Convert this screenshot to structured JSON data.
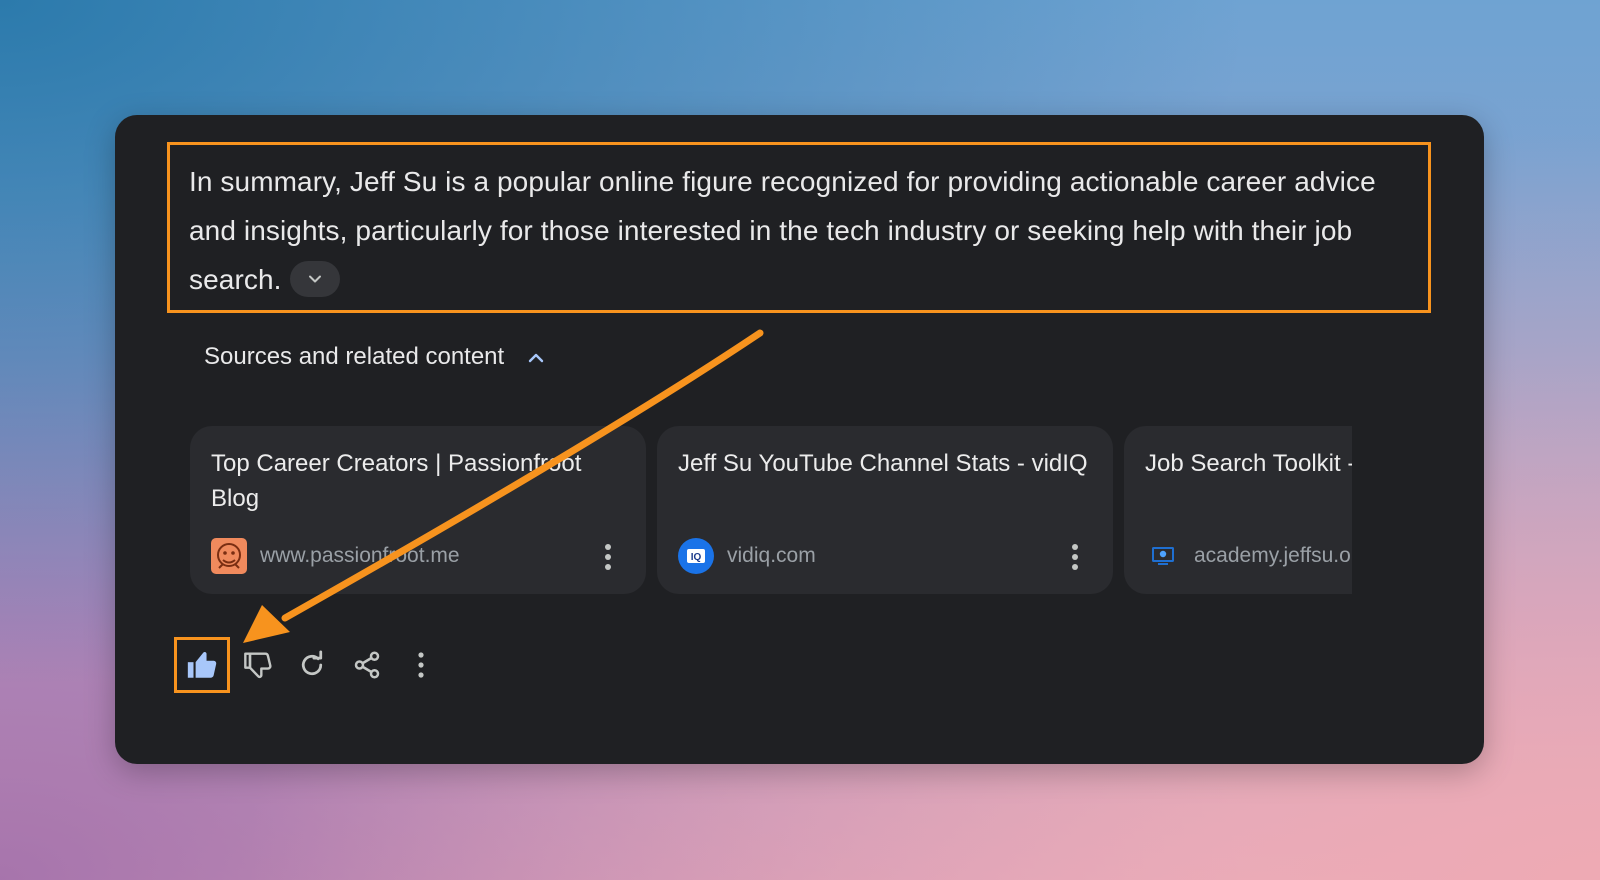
{
  "summary": {
    "text": "In summary, Jeff Su is a popular online figure recognized for providing actionable career advice and insights, particularly for those interested in the tech industry or seeking help with their job search."
  },
  "sources": {
    "header": "Sources and related content",
    "items": [
      {
        "title": "Top Career Creators | Passionfroot Blog",
        "domain": "www.passionfroot.me",
        "favicon": "passionfroot-logo"
      },
      {
        "title": "Jeff Su YouTube Channel Stats - vidIQ",
        "domain": "vidiq.com",
        "favicon": "vidiq-logo"
      },
      {
        "title": "Job Search Toolkit - Jeff Su",
        "domain": "academy.jeffsu.org",
        "favicon": "jeffsu-academy-logo"
      }
    ]
  },
  "actions": [
    "thumbs-up-icon",
    "thumbs-down-icon",
    "refresh-icon",
    "share-icon",
    "more-vert-icon"
  ],
  "colors": {
    "highlight": "#f7931e",
    "card_bg": "#1f2023",
    "source_card_bg": "#2a2b2f",
    "accent_blue": "#a8c7fa"
  }
}
